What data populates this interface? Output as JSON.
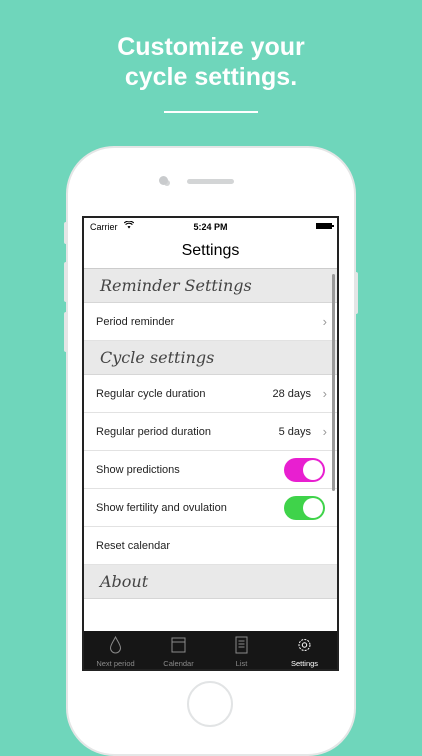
{
  "promo": {
    "headline_line1": "Customize your",
    "headline_line2": "cycle settings."
  },
  "status_bar": {
    "carrier": "Carrier",
    "time": "5:24 PM",
    "wifi_icon": "wifi-icon",
    "battery_icon": "battery-icon"
  },
  "nav": {
    "title": "Settings"
  },
  "sections": {
    "reminder": {
      "header": "Reminder Settings",
      "period_reminder": "Period reminder"
    },
    "cycle": {
      "header": "Cycle settings",
      "cycle_duration_label": "Regular cycle duration",
      "cycle_duration_value": "28 days",
      "period_duration_label": "Regular period duration",
      "period_duration_value": "5 days",
      "show_predictions_label": "Show predictions",
      "show_fertility_label": "Show fertility and ovulation",
      "reset_calendar_label": "Reset calendar"
    },
    "about": {
      "header": "About"
    }
  },
  "toggles": {
    "predictions_on": true,
    "fertility_on": true
  },
  "colors": {
    "background": "#6fd6bb",
    "predictions_toggle": "#e81fd0",
    "fertility_toggle": "#3fd34a",
    "tabbar": "#161616"
  },
  "tabs": [
    {
      "label": "Next period",
      "icon": "drop-icon",
      "active": false
    },
    {
      "label": "Calendar",
      "icon": "calendar-icon",
      "active": false
    },
    {
      "label": "List",
      "icon": "list-icon",
      "active": false
    },
    {
      "label": "Settings",
      "icon": "gear-icon",
      "active": true
    }
  ]
}
